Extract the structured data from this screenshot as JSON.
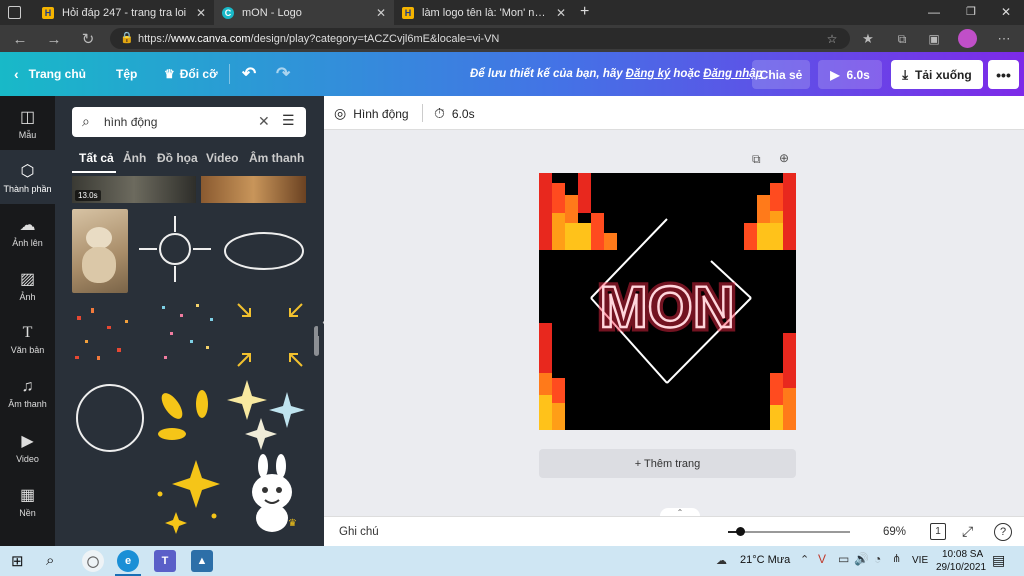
{
  "browser": {
    "tabs": [
      {
        "title": "Hỏi đáp 247 - trang tra loi",
        "favicon": "H"
      },
      {
        "title": "mON - Logo",
        "favicon": "C"
      },
      {
        "title": "làm logo tên là: 'Mon' nha mn N",
        "favicon": "H"
      }
    ],
    "new_tab": "+",
    "url_prefix": "https://",
    "url_domain": "www.canva.com",
    "url_path": "/design/play?category=tACZCvjl6mE&locale=vi-VN"
  },
  "header": {
    "home": "Trang chủ",
    "file": "Tệp",
    "resize": "Đổi cỡ",
    "message_prefix": "Để lưu thiết kế của bạn, hãy",
    "register": "Đăng ký",
    "or": "hoặc",
    "login": "Đăng nhập",
    "share": "Chia sẻ",
    "play_duration": "6.0s",
    "download": "Tải xuống"
  },
  "rail": [
    {
      "label": "Mẫu",
      "icon": "template-icon"
    },
    {
      "label": "Thành phần",
      "icon": "elements-icon"
    },
    {
      "label": "Ảnh lên",
      "icon": "upload-icon"
    },
    {
      "label": "Ảnh",
      "icon": "photo-icon"
    },
    {
      "label": "Văn bản",
      "icon": "text-icon"
    },
    {
      "label": "Âm thanh",
      "icon": "music-icon"
    },
    {
      "label": "Video",
      "icon": "video-icon"
    },
    {
      "label": "Nền",
      "icon": "background-icon"
    }
  ],
  "panel": {
    "search_value": "hình động",
    "categories": [
      "Tất cả",
      "Ảnh",
      "Đồ họa",
      "Video",
      "Âm thanh"
    ],
    "video_duration": "13.0s"
  },
  "toolbar": {
    "animate": "Hình động",
    "duration": "6.0s"
  },
  "design": {
    "text": "MON",
    "neon_color": "#ff2a4a"
  },
  "add_page": "+ Thêm trang",
  "bottom": {
    "notes": "Ghi chú",
    "zoom": "69%",
    "page_count": "1",
    "help": "?"
  },
  "taskbar": {
    "weather": "21°C Mưa",
    "lang": "VIE",
    "time": "10:08 SA",
    "date": "29/10/2021"
  },
  "colors": {
    "canva_teal": "#18b9c8",
    "canva_purple": "#7d2ae8",
    "panel_bg": "#293039"
  }
}
